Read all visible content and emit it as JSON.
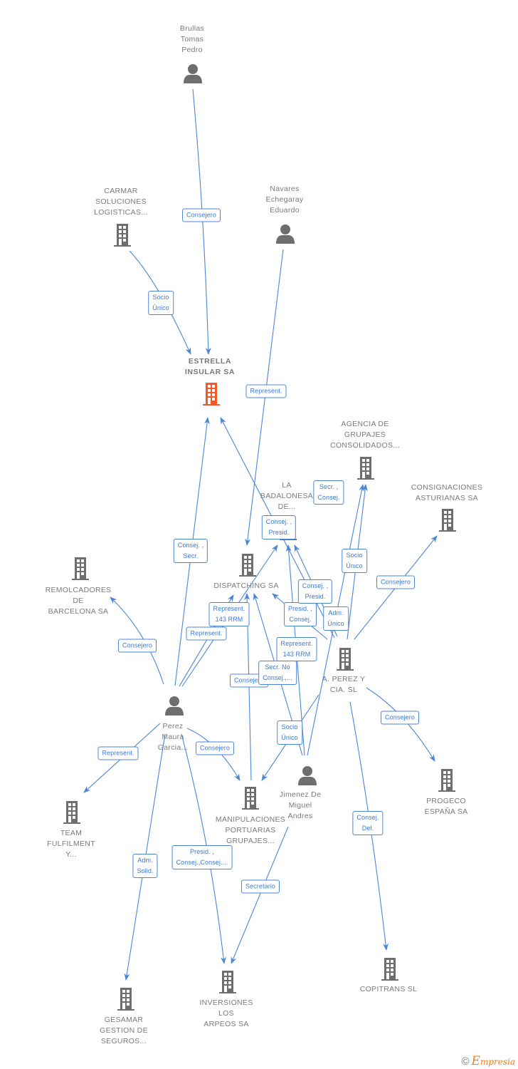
{
  "diagram": {
    "nodes": [
      {
        "type": "person",
        "label": "Brullas\nTomas\nPedro"
      },
      {
        "type": "company",
        "label": "CARMAR\nSOLUCIONES\nLOGISTICAS..."
      },
      {
        "type": "person",
        "label": "Navares\nEchegaray\nEduardo"
      },
      {
        "type": "company",
        "highlighted": true,
        "label": "ESTRELLA\nINSULAR SA"
      },
      {
        "type": "company",
        "label": "AGENCIA DE\nGRUPAJES\nCONSOLIDADOS..."
      },
      {
        "type": "company",
        "label": "CONSIGNACIONES\nASTURIANAS SA"
      },
      {
        "type": "company",
        "label": "LA\nBADALONESA\nDE..."
      },
      {
        "type": "company",
        "label": "DISPATCHING SA"
      },
      {
        "type": "company",
        "label": "REMOLCADORES\nDE\nBARCELONA SA"
      },
      {
        "type": "company",
        "label": "A.  PEREZ Y\nCIA. SL"
      },
      {
        "type": "person",
        "label": "Perez\nMaura\nGarcia..."
      },
      {
        "type": "company",
        "label": "PROGECO\nESPAÑA SA"
      },
      {
        "type": "company",
        "label": "TEAM\nFULFILMENT\nY..."
      },
      {
        "type": "company",
        "label": "MANIPULACIONES\nPORTUARIAS\nGRUPAJES..."
      },
      {
        "type": "person",
        "label": "Jimenez De\nMiguel\nAndres"
      },
      {
        "type": "company",
        "label": "GESAMAR\nGESTION DE\nSEGUROS..."
      },
      {
        "type": "company",
        "label": "INVERSIONES\nLOS\nARPEOS SA"
      },
      {
        "type": "company",
        "label": "COPITRANS SL"
      }
    ],
    "edges": [
      {
        "from": "Brullas Tomas Pedro",
        "to": "ESTRELLA INSULAR SA",
        "label": "Consejero"
      },
      {
        "from": "CARMAR SOLUCIONES LOGISTICAS...",
        "to": "ESTRELLA INSULAR SA",
        "label": "Socio\nÚnico"
      },
      {
        "from": "Navares Echegaray Eduardo",
        "to": "DISPATCHING SA",
        "label": "Represent."
      },
      {
        "from": "Perez Maura Garcia...",
        "to": "ESTRELLA INSULAR SA",
        "label": "Consej. ,\nSecr."
      },
      {
        "from": "A. PEREZ Y CIA. SL",
        "to": "ESTRELLA INSULAR SA",
        "label": "Consej. ,\nPresid."
      },
      {
        "from": "A. PEREZ Y CIA. SL",
        "to": "LA BADALONESA DE...",
        "label": "Consej. ,\nPresid."
      },
      {
        "from": "A. PEREZ Y CIA. SL",
        "to": "DISPATCHING SA",
        "label": "Presid. ,\nConsej."
      },
      {
        "from": "A. PEREZ Y CIA. SL",
        "to": "AGENCIA DE GRUPAJES CONSOLIDADOS...",
        "label": "Socio\nÚnico"
      },
      {
        "from": "Jimenez De Miguel Andres",
        "to": "AGENCIA DE GRUPAJES CONSOLIDADOS...",
        "label": "Adm.\nÚnico"
      },
      {
        "from": "Jimenez De Miguel Andres",
        "to": "LA BADALONESA DE...",
        "label": "Represent.\n143 RRM"
      },
      {
        "from": "Jimenez De Miguel Andres",
        "to": "DISPATCHING SA",
        "label": "Secr.  No\nConsej.,..."
      },
      {
        "from": "Jimenez De Miguel Andres",
        "to": "INVERSIONES LOS ARPEOS SA",
        "label": "Secretario"
      },
      {
        "from": "Perez Maura Garcia...",
        "to": "REMOLCADORES DE BARCELONA SA",
        "label": "Consejero"
      },
      {
        "from": "Perez Maura Garcia...",
        "to": "DISPATCHING SA",
        "label": "Represent."
      },
      {
        "from": "Perez Maura Garcia...",
        "to": "LA BADALONESA DE...",
        "label": "Represent.\n143 RRM"
      },
      {
        "from": "Perez Maura Garcia...",
        "to": "TEAM FULFILMENT Y...",
        "label": "Represent."
      },
      {
        "from": "Perez Maura Garcia...",
        "to": "MANIPULACIONES PORTUARIAS GRUPAJES...",
        "label": "Consejero"
      },
      {
        "from": "Perez Maura Garcia...",
        "to": "GESAMAR GESTION DE SEGUROS...",
        "label": "Adm.\nSolid."
      },
      {
        "from": "Perez Maura Garcia...",
        "to": "INVERSIONES LOS ARPEOS SA",
        "label": "Presid. ,\nConsej.,Consej...."
      },
      {
        "from": "MANIPULACIONES PORTUARIAS GRUPAJES...",
        "to": "DISPATCHING SA",
        "label": "Consejero"
      },
      {
        "from": "A. PEREZ Y CIA. SL",
        "to": "CONSIGNACIONES ASTURIANAS SA",
        "label": "Consejero"
      },
      {
        "from": "A. PEREZ Y CIA. SL",
        "to": "PROGECO ESPAÑA SA",
        "label": "Consejero"
      },
      {
        "from": "A. PEREZ Y CIA. SL",
        "to": "COPITRANS SL",
        "label": "Consej.\nDel."
      },
      {
        "from": "A. PEREZ Y CIA. SL",
        "to": "MANIPULACIONES PORTUARIAS GRUPAJES...",
        "label": "Socio\nÚnico"
      },
      {
        "label": "Secr. ,\nConsej."
      }
    ]
  },
  "colors": {
    "edge": "#4a86d8",
    "node_icon": "#6e6e6e",
    "highlight_node": "#f05a28",
    "node_label_text": "#7a7a7a",
    "edge_label_text": "#3a78d4"
  },
  "footer": {
    "copyright_symbol": "©",
    "brand_initial": "E",
    "brand_rest": "mpresia"
  }
}
